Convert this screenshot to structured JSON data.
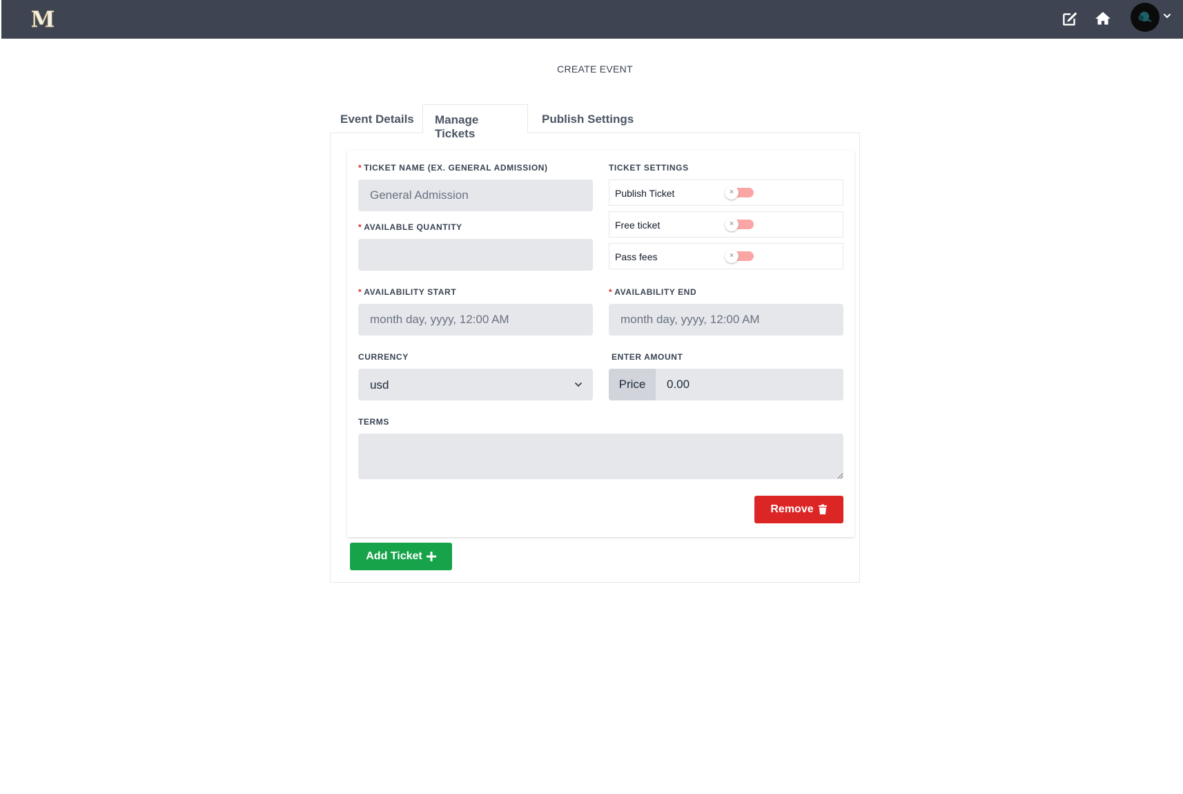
{
  "header": {
    "logo_letter": "M",
    "icons": [
      "edit-icon",
      "home-icon",
      "avatar",
      "chevron-down-icon"
    ],
    "background": "#3e4452"
  },
  "page": {
    "title": "CREATE EVENT"
  },
  "tabs": [
    {
      "label": "Event Details",
      "active": false
    },
    {
      "label": "Manage Tickets",
      "active": true
    },
    {
      "label": "Publish Settings",
      "active": false
    }
  ],
  "ticket": {
    "name_label": "Ticket Name (ex. General Admission)",
    "name_placeholder": "General Admission",
    "quantity_label": "Available Quantity",
    "quantity_placeholder": "",
    "start_label": "Availability Start",
    "start_placeholder": "month day, yyyy, 12:00 AM",
    "end_label": "Availability End",
    "end_placeholder": "month day, yyyy, 12:00 AM",
    "currency_label": "Currency",
    "currency_value": "usd",
    "amount_label": "Enter Amount",
    "price_addon": "Price",
    "price_value": "0.00",
    "terms_label": "Terms",
    "settings_label": "Ticket Settings",
    "settings": [
      {
        "label": "Publish Ticket",
        "enabled": false
      },
      {
        "label": "Free ticket",
        "enabled": false
      },
      {
        "label": "Pass fees",
        "enabled": false
      }
    ],
    "remove_label": "Remove"
  },
  "add_ticket_label": "Add Ticket",
  "colors": {
    "danger": "#dc2626",
    "success": "#16a34a",
    "toggle_off": "#fca5a5",
    "required": "#dc2626"
  }
}
